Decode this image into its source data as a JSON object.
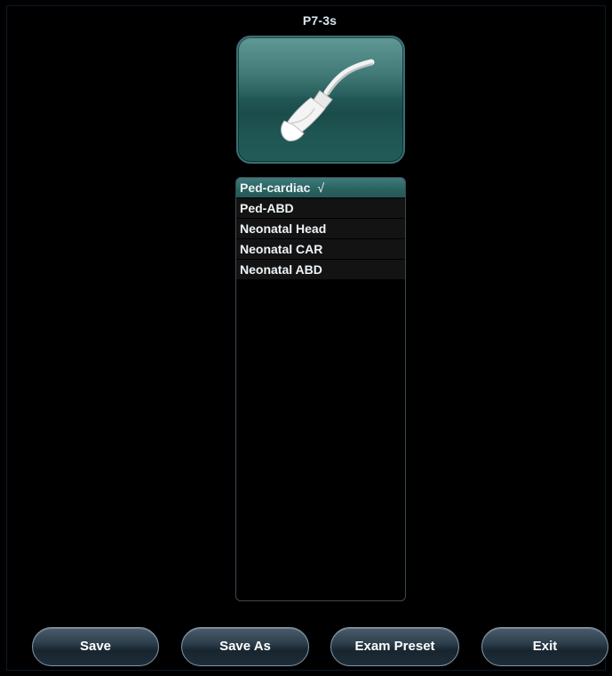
{
  "probe": {
    "name": "P7-3s"
  },
  "presets": [
    {
      "label": "Ped-cardiac",
      "selected": true,
      "check": "√"
    },
    {
      "label": "Ped-ABD",
      "selected": false,
      "check": ""
    },
    {
      "label": "Neonatal Head",
      "selected": false,
      "check": ""
    },
    {
      "label": "Neonatal CAR",
      "selected": false,
      "check": ""
    },
    {
      "label": "Neonatal ABD",
      "selected": false,
      "check": ""
    }
  ],
  "buttons": {
    "save": "Save",
    "save_as": "Save As",
    "exam_preset": "Exam Preset",
    "exit": "Exit"
  },
  "icons": {
    "probe": "ultrasound-probe-icon"
  },
  "colors": {
    "background": "#000000",
    "tile_teal": "#2b6462",
    "selected_row": "#2b6462",
    "list_row": "#131313",
    "button_border": "#8397a6"
  }
}
